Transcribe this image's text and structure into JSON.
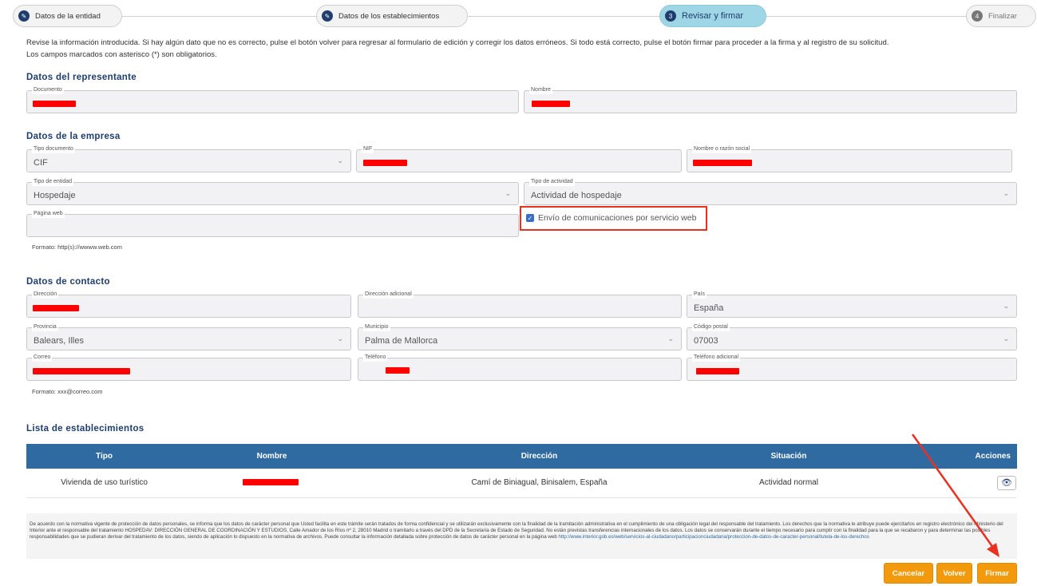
{
  "stepper": {
    "steps": [
      {
        "num": "✎",
        "label": "Datos de la entidad"
      },
      {
        "num": "✎",
        "label": "Datos de los establecimientos"
      },
      {
        "num": "3",
        "label": "Revisar y firmar"
      },
      {
        "num": "4",
        "label": "Finalizar"
      }
    ]
  },
  "intro": {
    "line1": "Revise la información introducida. Si hay algún dato que no es correcto, pulse el botón volver para regresar al formulario de edición y corregir los datos erróneos. Si todo está correcto, pulse el botón firmar para proceder a la firma y al registro de su solicitud.",
    "line2": "Los campos marcados con asterisco (*) son obligatorios."
  },
  "representante": {
    "title": "Datos del representante",
    "documento_label": "Documento",
    "nombre_label": "Nombre"
  },
  "empresa": {
    "title": "Datos de la empresa",
    "tipo_documento_label": "Tipo documento",
    "tipo_documento_value": "CIF",
    "nif_label": "NIF",
    "razon_social_label": "Nombre o razón social",
    "tipo_entidad_label": "Tipo de entidad",
    "tipo_entidad_value": "Hospedaje",
    "tipo_actividad_label": "Tipo de actividad",
    "tipo_actividad_value": "Actividad de hospedaje",
    "web_label": "Página web",
    "web_hint": "Formato: http(s)://wwww.web.com",
    "checkbox_label": "Envío de comunicaciones por servicio web",
    "checkbox_checked": true
  },
  "contacto": {
    "title": "Datos de contacto",
    "direccion_label": "Dirección",
    "direccion_adicional_label": "Dirección adicional",
    "pais_label": "País",
    "pais_value": "España",
    "provincia_label": "Provincia",
    "provincia_value": "Balears, Illes",
    "municipio_label": "Municipio",
    "municipio_value": "Palma de Mallorca",
    "cp_label": "Código postal",
    "cp_value": "07003",
    "correo_label": "Correo",
    "telefono_label": "Teléfono",
    "telefono_adicional_label": "Teléfono adicional",
    "correo_hint": "Formato: xxx@correo.com"
  },
  "establecimientos": {
    "title": "Lista de establecimientos",
    "headers": [
      "Tipo",
      "Nombre",
      "Dirección",
      "Situación",
      "Acciones"
    ],
    "rows": [
      {
        "tipo": "Vivienda de uso turístico",
        "direccion": "Camí de Biniagual, Binisalem, España",
        "situacion": "Actividad normal"
      }
    ]
  },
  "legal": {
    "text": "De acuerdo con la normativa vigente de protección de datos personales, se informa que los datos de carácter personal que Usted facilita en este trámite serán tratados de forma confidencial y se utilizarán exclusivamente con la finalidad de la tramitación administrativa en el cumplimiento de una obligación legal del responsable del tratamiento. Los derechos que la normativa le atribuye puede ejercitarlos en registro electrónico del Ministerio del Interior ante el responsable del tratamiento HOSPEDAV: DIRECCIÓN GENERAL DE COORDINACIÓN Y ESTUDIOS, Calle Amador de los Ríos nº 2, 28010 Madrid o tramitarlo a través del DPD de la Secretaría de Estado de Seguridad. No están previstas transferencias internacionales de los datos. Los datos se conservarán durante el tiempo necesario para cumplir con la finalidad para la que se recabaron y para determinar las posibles responsabilidades que se pudieran derivar del tratamiento de los datos, siendo de aplicación lo dispuesto en la normativa de archivos. Puede consultar la información detallada sobre protección de datos de carácter personal en la página web",
    "link": "http://www.interior.gob.es/web/servicios-al-ciudadano/participacionciudadana/proteccion-de-datos-de-caracter-personal/tutela-de-los-derechos"
  },
  "buttons": {
    "cancelar": "Cancelar",
    "volver": "Volver",
    "firmar": "Firmar"
  },
  "colors": {
    "accent": "#1f3d6d",
    "table_header": "#2f6aa0",
    "button": "#f39a0c",
    "highlight": "#e8311e",
    "redaction": "#ff0000"
  }
}
